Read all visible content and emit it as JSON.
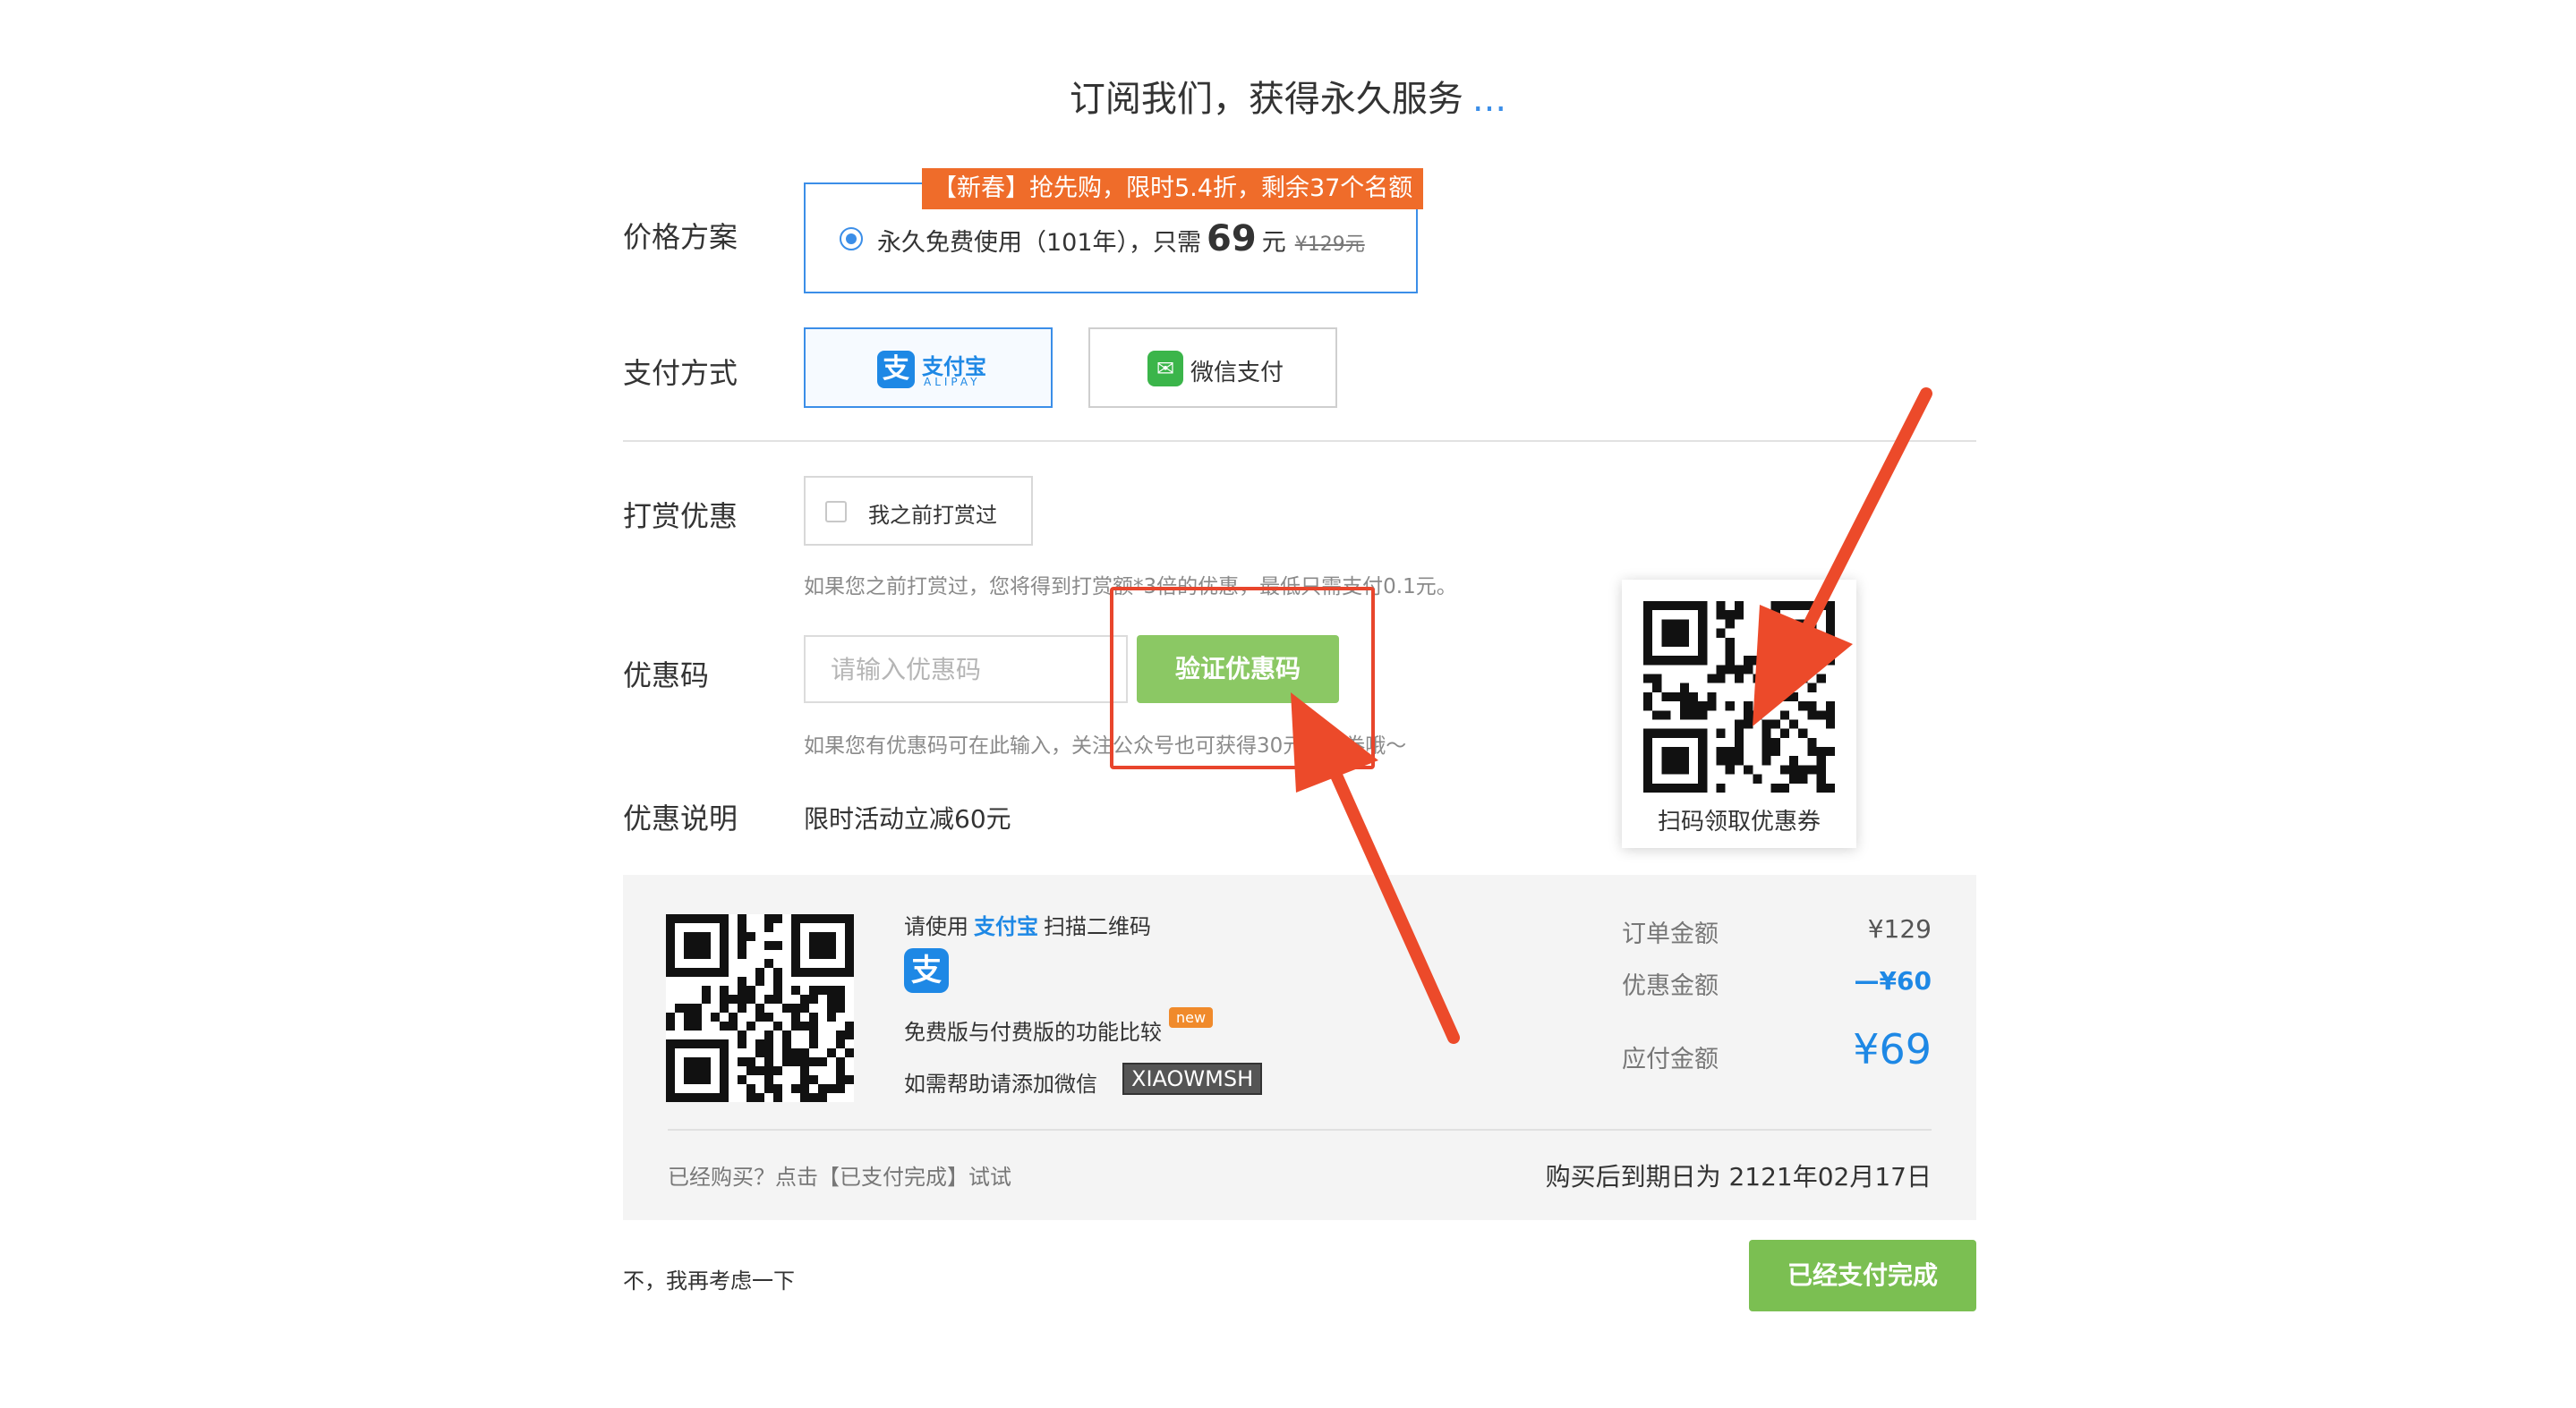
{
  "page": {
    "title": "订阅我们，获得永久服务",
    "title_suffix": "..."
  },
  "price_plan": {
    "label": "价格方案",
    "promo": "【新春】抢先购，限时5.4折，剩余37个名额",
    "option_text": "永久免费使用（101年），只需",
    "price": "69",
    "unit": "元",
    "original_price": "¥129元",
    "selected": true
  },
  "payment": {
    "label": "支付方式",
    "alipay_name": "支付宝",
    "alipay_sub": "ALIPAY",
    "alipay_icon": "支",
    "wechat_label": "微信支付"
  },
  "tip": {
    "label": "打赏优惠",
    "checkbox_label": "我之前打赏过",
    "hint": "如果您之前打赏过，您将得到打赏额*3倍的优惠，最低只需支付0.1元。"
  },
  "coupon": {
    "label": "优惠码",
    "placeholder": "请输入优惠码",
    "verify_label": "验证优惠码",
    "hint": "如果您有优惠码可在此输入，关注公众号也可获得30元优惠券哦～"
  },
  "promo_desc": {
    "label": "优惠说明",
    "text": "限时活动立减60元"
  },
  "qr_card": {
    "text": "扫码领取优惠券"
  },
  "panel": {
    "scan_prefix": "请使用",
    "scan_highlight": "支付宝",
    "scan_suffix": "扫描二维码",
    "alipay_icon": "支",
    "compare_text": "免费版与付费版的功能比较",
    "new_badge": "new",
    "help_text": "如需帮助请添加微信",
    "wechat_id": "XIAOWMSH",
    "order_amount_label": "订单金额",
    "order_amount": "¥129",
    "discount_label": "优惠金额",
    "discount": "—¥60",
    "payable_label": "应付金额",
    "payable": "¥69",
    "bought_hint": "已经购买？点击【已支付完成】试试",
    "expire_text": "购买后到期日为 2121年02月17日"
  },
  "footer": {
    "reconsider": "不，我再考虑一下",
    "done_label": "已经支付完成"
  },
  "colors": {
    "accent": "#3b8ee8",
    "promo": "#ef6c2a",
    "green": "#7bbf52",
    "arrow": "#ec4a2a"
  }
}
